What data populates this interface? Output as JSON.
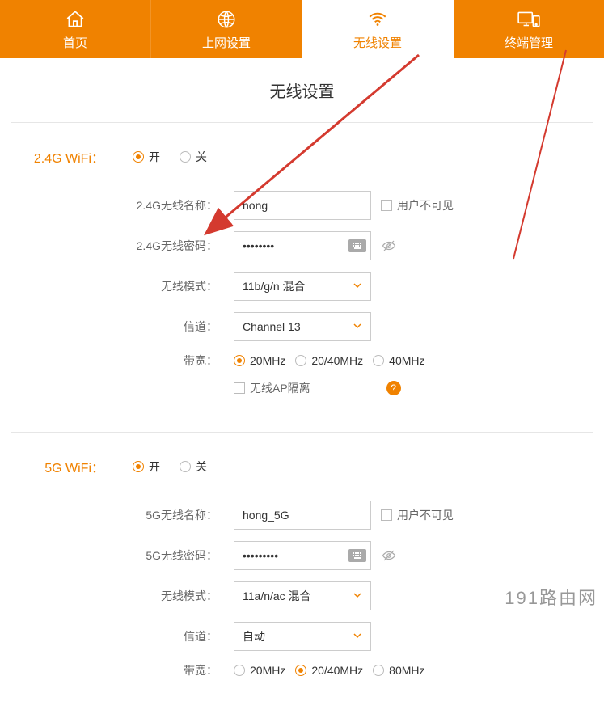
{
  "tabs": [
    {
      "label": "首页"
    },
    {
      "label": "上网设置"
    },
    {
      "label": "无线设置"
    },
    {
      "label": "终端管理"
    }
  ],
  "page_title": "无线设置",
  "section24": {
    "title": "2.4G WiFi：",
    "on": "开",
    "off": "关",
    "ssid_label": "2.4G无线名称：",
    "ssid_value": "hong",
    "hide_ssid": "用户不可见",
    "pwd_label": "2.4G无线密码：",
    "pwd_value": "••••••••",
    "mode_label": "无线模式：",
    "mode_value": "11b/g/n 混合",
    "channel_label": "信道：",
    "channel_value": "Channel 13",
    "bw_label": "带宽：",
    "bw_opts": [
      "20MHz",
      "20/40MHz",
      "40MHz"
    ],
    "ap_isolate": "无线AP隔离"
  },
  "section5": {
    "title": "5G WiFi：",
    "on": "开",
    "off": "关",
    "ssid_label": "5G无线名称：",
    "ssid_value": "hong_5G",
    "hide_ssid": "用户不可见",
    "pwd_label": "5G无线密码：",
    "pwd_value": "•••••••••",
    "mode_label": "无线模式：",
    "mode_value": "11a/n/ac 混合",
    "channel_label": "信道：",
    "channel_value": "自动",
    "bw_label": "带宽：",
    "bw_opts": [
      "20MHz",
      "20/40MHz",
      "80MHz"
    ]
  },
  "watermark": "191路由网",
  "help_symbol": "?"
}
